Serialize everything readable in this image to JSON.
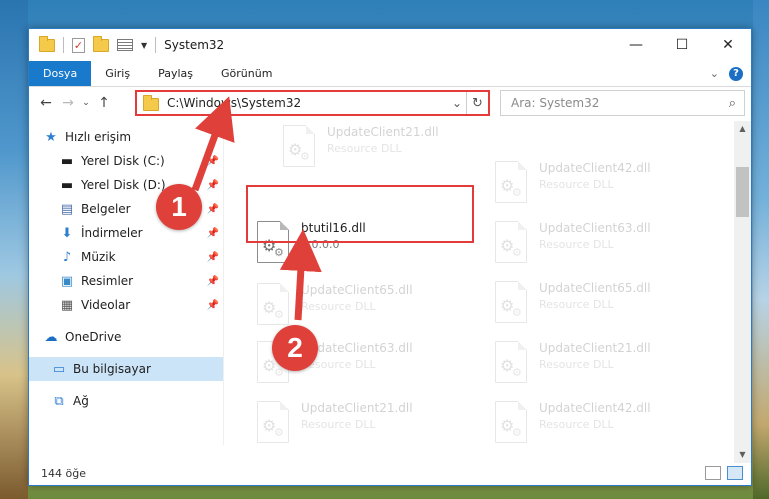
{
  "window": {
    "title": "System32",
    "controls": {
      "minimize": "—",
      "maximize": "☐",
      "close": "✕"
    }
  },
  "menu": {
    "items": [
      "Dosya",
      "Giriş",
      "Paylaş",
      "Görünüm"
    ],
    "active": "Dosya"
  },
  "address": {
    "path": "C:\\Windows\\System32",
    "search_placeholder": "Ara: System32"
  },
  "sidebar": {
    "quick_access": "Hızlı erişim",
    "items": [
      {
        "label": "Yerel Disk (C:)",
        "icon": "drive-icon",
        "pinned": true
      },
      {
        "label": "Yerel Disk (D:)",
        "icon": "drive-icon",
        "pinned": true
      },
      {
        "label": "Belgeler",
        "icon": "documents-icon",
        "pinned": true
      },
      {
        "label": "İndirmeler",
        "icon": "download-icon",
        "pinned": true
      },
      {
        "label": "Müzik",
        "icon": "music-icon",
        "pinned": true
      },
      {
        "label": "Resimler",
        "icon": "pictures-icon",
        "pinned": true
      },
      {
        "label": "Videolar",
        "icon": "videos-icon",
        "pinned": true
      }
    ],
    "onedrive": "OneDrive",
    "this_pc": "Bu bilgisayar",
    "network": "Ağ"
  },
  "files": {
    "selected": {
      "name": "btutil16.dll",
      "version": "1.0.0.0"
    },
    "left_column": [
      {
        "name": "UpdateClient21.dll",
        "type": "Resource DLL"
      },
      {
        "name": "UpdateClient65.dll",
        "type": "Resource DLL"
      },
      {
        "name": "UpdateClient63.dll",
        "type": "Resource DLL"
      },
      {
        "name": "UpdateClient21.dll",
        "type": "Resource DLL"
      }
    ],
    "right_column": [
      {
        "name": "UpdateClient42.dll",
        "type": "Resource DLL"
      },
      {
        "name": "UpdateClient63.dll",
        "type": "Resource DLL"
      },
      {
        "name": "UpdateClient65.dll",
        "type": "Resource DLL"
      },
      {
        "name": "UpdateClient21.dll",
        "type": "Resource DLL"
      },
      {
        "name": "UpdateClient42.dll",
        "type": "Resource DLL"
      }
    ]
  },
  "status": {
    "count": "144 öğe"
  },
  "annotations": {
    "marker1": "1",
    "marker2": "2",
    "accent": "#e0403a"
  }
}
